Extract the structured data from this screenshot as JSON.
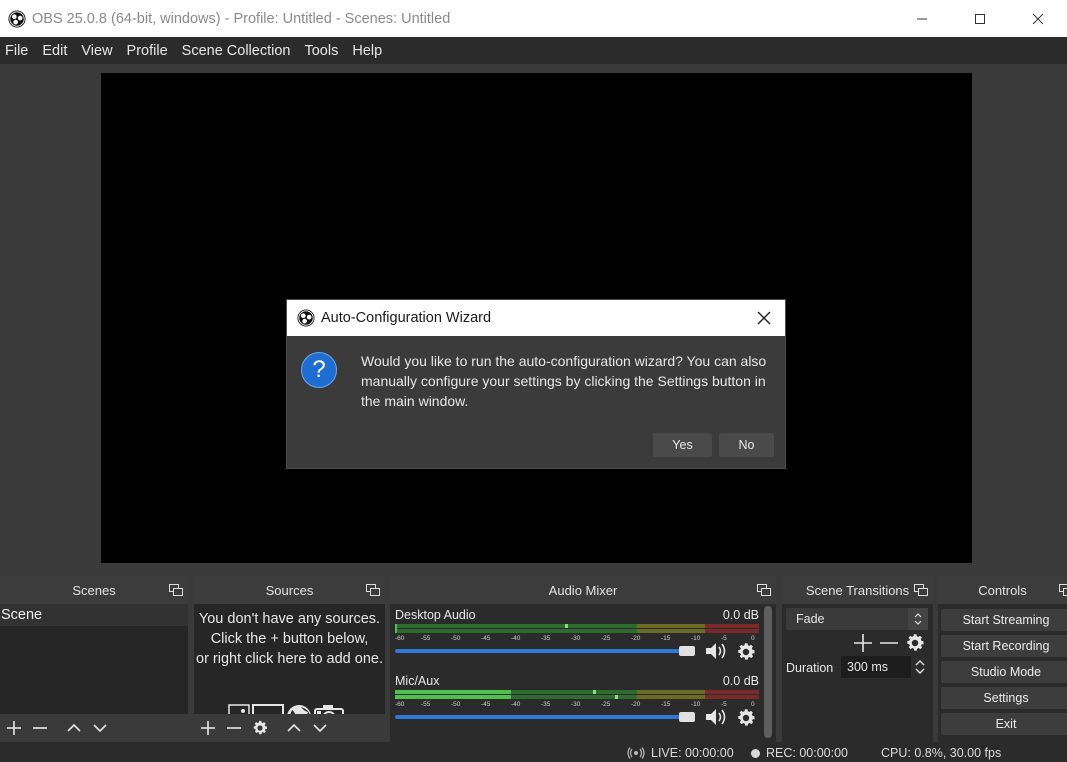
{
  "window": {
    "title": "OBS 25.0.8 (64-bit, windows) - Profile: Untitled - Scenes: Untitled"
  },
  "menu": [
    "File",
    "Edit",
    "View",
    "Profile",
    "Scene Collection",
    "Tools",
    "Help"
  ],
  "dialog": {
    "title": "Auto-Configuration Wizard",
    "message": "Would you like to run the auto-configuration wizard? You can also manually configure your settings by clicking the Settings button in the main window.",
    "yes_label": "Yes",
    "no_label": "No"
  },
  "scenes": {
    "title": "Scenes",
    "items": [
      "Scene"
    ]
  },
  "sources": {
    "title": "Sources",
    "empty_line1": "You don't have any sources.",
    "empty_line2": "Click the + button below,",
    "empty_line3": "or right click here to add one."
  },
  "mixer": {
    "title": "Audio Mixer",
    "tick_labels": [
      "-60",
      "-55",
      "-50",
      "-45",
      "-40",
      "-35",
      "-30",
      "-25",
      "-20",
      "-15",
      "-10",
      "-5",
      "0"
    ],
    "channels": [
      {
        "name": "Desktop Audio",
        "db": "0.0 dB",
        "volume": 1.0
      },
      {
        "name": "Mic/Aux",
        "db": "0.0 dB",
        "volume": 1.0
      }
    ]
  },
  "transitions": {
    "title": "Scene Transitions",
    "selected": "Fade",
    "duration_label": "Duration",
    "duration_value": "300 ms"
  },
  "controls": {
    "title": "Controls",
    "start_streaming": "Start Streaming",
    "start_recording": "Start Recording",
    "studio_mode": "Studio Mode",
    "settings": "Settings",
    "exit": "Exit"
  },
  "status": {
    "live": "LIVE: 00:00:00",
    "rec": "REC: 00:00:00",
    "cpu": "CPU: 0.8%, 30.00 fps"
  },
  "colors": {
    "accent_blue": "#1f6dd0",
    "meter_green": "#4dc04d",
    "meter_yellow": "#b8b83a",
    "meter_red": "#c24040"
  }
}
